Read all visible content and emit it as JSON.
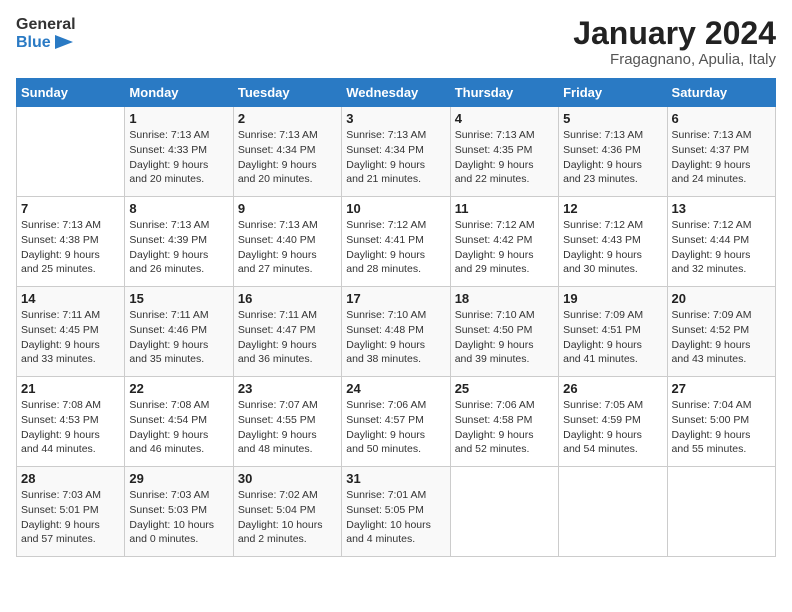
{
  "header": {
    "logo_general": "General",
    "logo_blue": "Blue",
    "month_title": "January 2024",
    "location": "Fragagnano, Apulia, Italy"
  },
  "days_of_week": [
    "Sunday",
    "Monday",
    "Tuesday",
    "Wednesday",
    "Thursday",
    "Friday",
    "Saturday"
  ],
  "weeks": [
    [
      {
        "day": "",
        "info": ""
      },
      {
        "day": "1",
        "info": "Sunrise: 7:13 AM\nSunset: 4:33 PM\nDaylight: 9 hours\nand 20 minutes."
      },
      {
        "day": "2",
        "info": "Sunrise: 7:13 AM\nSunset: 4:34 PM\nDaylight: 9 hours\nand 20 minutes."
      },
      {
        "day": "3",
        "info": "Sunrise: 7:13 AM\nSunset: 4:34 PM\nDaylight: 9 hours\nand 21 minutes."
      },
      {
        "day": "4",
        "info": "Sunrise: 7:13 AM\nSunset: 4:35 PM\nDaylight: 9 hours\nand 22 minutes."
      },
      {
        "day": "5",
        "info": "Sunrise: 7:13 AM\nSunset: 4:36 PM\nDaylight: 9 hours\nand 23 minutes."
      },
      {
        "day": "6",
        "info": "Sunrise: 7:13 AM\nSunset: 4:37 PM\nDaylight: 9 hours\nand 24 minutes."
      }
    ],
    [
      {
        "day": "7",
        "info": "Sunrise: 7:13 AM\nSunset: 4:38 PM\nDaylight: 9 hours\nand 25 minutes."
      },
      {
        "day": "8",
        "info": "Sunrise: 7:13 AM\nSunset: 4:39 PM\nDaylight: 9 hours\nand 26 minutes."
      },
      {
        "day": "9",
        "info": "Sunrise: 7:13 AM\nSunset: 4:40 PM\nDaylight: 9 hours\nand 27 minutes."
      },
      {
        "day": "10",
        "info": "Sunrise: 7:12 AM\nSunset: 4:41 PM\nDaylight: 9 hours\nand 28 minutes."
      },
      {
        "day": "11",
        "info": "Sunrise: 7:12 AM\nSunset: 4:42 PM\nDaylight: 9 hours\nand 29 minutes."
      },
      {
        "day": "12",
        "info": "Sunrise: 7:12 AM\nSunset: 4:43 PM\nDaylight: 9 hours\nand 30 minutes."
      },
      {
        "day": "13",
        "info": "Sunrise: 7:12 AM\nSunset: 4:44 PM\nDaylight: 9 hours\nand 32 minutes."
      }
    ],
    [
      {
        "day": "14",
        "info": "Sunrise: 7:11 AM\nSunset: 4:45 PM\nDaylight: 9 hours\nand 33 minutes."
      },
      {
        "day": "15",
        "info": "Sunrise: 7:11 AM\nSunset: 4:46 PM\nDaylight: 9 hours\nand 35 minutes."
      },
      {
        "day": "16",
        "info": "Sunrise: 7:11 AM\nSunset: 4:47 PM\nDaylight: 9 hours\nand 36 minutes."
      },
      {
        "day": "17",
        "info": "Sunrise: 7:10 AM\nSunset: 4:48 PM\nDaylight: 9 hours\nand 38 minutes."
      },
      {
        "day": "18",
        "info": "Sunrise: 7:10 AM\nSunset: 4:50 PM\nDaylight: 9 hours\nand 39 minutes."
      },
      {
        "day": "19",
        "info": "Sunrise: 7:09 AM\nSunset: 4:51 PM\nDaylight: 9 hours\nand 41 minutes."
      },
      {
        "day": "20",
        "info": "Sunrise: 7:09 AM\nSunset: 4:52 PM\nDaylight: 9 hours\nand 43 minutes."
      }
    ],
    [
      {
        "day": "21",
        "info": "Sunrise: 7:08 AM\nSunset: 4:53 PM\nDaylight: 9 hours\nand 44 minutes."
      },
      {
        "day": "22",
        "info": "Sunrise: 7:08 AM\nSunset: 4:54 PM\nDaylight: 9 hours\nand 46 minutes."
      },
      {
        "day": "23",
        "info": "Sunrise: 7:07 AM\nSunset: 4:55 PM\nDaylight: 9 hours\nand 48 minutes."
      },
      {
        "day": "24",
        "info": "Sunrise: 7:06 AM\nSunset: 4:57 PM\nDaylight: 9 hours\nand 50 minutes."
      },
      {
        "day": "25",
        "info": "Sunrise: 7:06 AM\nSunset: 4:58 PM\nDaylight: 9 hours\nand 52 minutes."
      },
      {
        "day": "26",
        "info": "Sunrise: 7:05 AM\nSunset: 4:59 PM\nDaylight: 9 hours\nand 54 minutes."
      },
      {
        "day": "27",
        "info": "Sunrise: 7:04 AM\nSunset: 5:00 PM\nDaylight: 9 hours\nand 55 minutes."
      }
    ],
    [
      {
        "day": "28",
        "info": "Sunrise: 7:03 AM\nSunset: 5:01 PM\nDaylight: 9 hours\nand 57 minutes."
      },
      {
        "day": "29",
        "info": "Sunrise: 7:03 AM\nSunset: 5:03 PM\nDaylight: 10 hours\nand 0 minutes."
      },
      {
        "day": "30",
        "info": "Sunrise: 7:02 AM\nSunset: 5:04 PM\nDaylight: 10 hours\nand 2 minutes."
      },
      {
        "day": "31",
        "info": "Sunrise: 7:01 AM\nSunset: 5:05 PM\nDaylight: 10 hours\nand 4 minutes."
      },
      {
        "day": "",
        "info": ""
      },
      {
        "day": "",
        "info": ""
      },
      {
        "day": "",
        "info": ""
      }
    ]
  ]
}
